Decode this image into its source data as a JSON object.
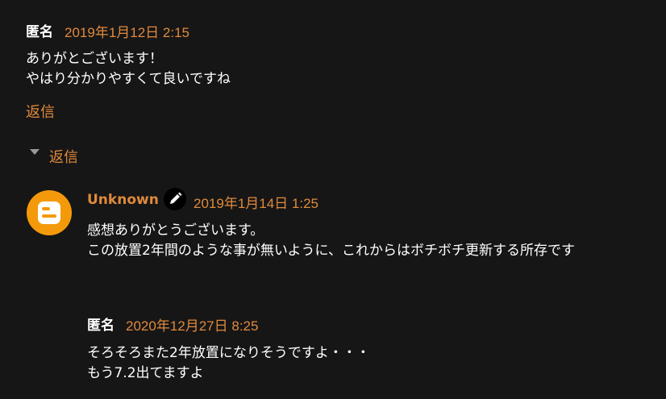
{
  "comments": [
    {
      "author": "匿名",
      "date": "2019年1月12日 2:15",
      "lines": [
        "ありがとございます！",
        "やはり分かりやすくて良いですね"
      ],
      "reply_label": "返信"
    }
  ],
  "replies_toggle": {
    "label": "返信",
    "icon": "caret-down-icon"
  },
  "replies": [
    {
      "author": "Unknown",
      "author_badge_icon": "pencil-icon",
      "avatar_icon": "blogger-logo",
      "date": "2019年1月14日 1:25",
      "lines": [
        "感想ありがとうございます。",
        "この放置2年間のような事が無いように、これからはボチボチ更新する所存です"
      ]
    },
    {
      "author": "匿名",
      "date": "2020年12月27日 8:25",
      "lines": [
        "そろそろまた2年放置になりそうですよ・・・",
        "もう7.2出てますよ"
      ]
    }
  ],
  "colors": {
    "background": "#161616",
    "accent": "#e08a3c",
    "text": "#ffffff",
    "avatar": "#f49a0a"
  }
}
